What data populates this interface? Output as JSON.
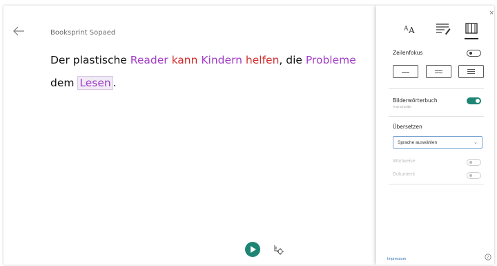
{
  "reader": {
    "doc_title": "Booksprint Sopaed",
    "line1": [
      {
        "text": "Der",
        "cls": ""
      },
      {
        "text": " plastische ",
        "cls": ""
      },
      {
        "text": "Reader",
        "cls": "noun"
      },
      {
        "text": " ",
        "cls": ""
      },
      {
        "text": "kann",
        "cls": "verb"
      },
      {
        "text": " ",
        "cls": ""
      },
      {
        "text": "Kindern",
        "cls": "noun"
      },
      {
        "text": " ",
        "cls": ""
      },
      {
        "text": "helfen",
        "cls": "verb"
      },
      {
        "text": ", die ",
        "cls": ""
      },
      {
        "text": "Probleme",
        "cls": "noun"
      }
    ],
    "line2_prefix": "dem ",
    "line2_word": "Lesen",
    "line2_suffix": ".",
    "colors": {
      "noun": "#a13fc6",
      "verb": "#d22b2b",
      "accent": "#1e8474"
    }
  },
  "controls": {
    "back_icon": "arrow-left-icon",
    "play_icon": "play-icon",
    "voice_icon": "voice-settings-icon"
  },
  "panel": {
    "tabs": [
      {
        "name": "text-options-tab",
        "icon": "text-size-icon"
      },
      {
        "name": "grammar-options-tab",
        "icon": "grammar-icon"
      },
      {
        "name": "reading-preferences-tab",
        "icon": "book-icon",
        "active": true
      }
    ],
    "close": "×",
    "line_focus_label": "Zeilenfokus",
    "line_focus_on": false,
    "picture_dictionary_label": "Bilderwörterbuch",
    "picture_dictionary_sub": "% Erschreibe",
    "picture_dictionary_on": true,
    "translate_label": "Übersetzen",
    "language_select_value": "Sprache auswählen",
    "word_toggle_label": "Wortweise",
    "document_toggle_label": "Dokument",
    "imprint_link": "Impressum",
    "help_icon": "help-icon"
  }
}
